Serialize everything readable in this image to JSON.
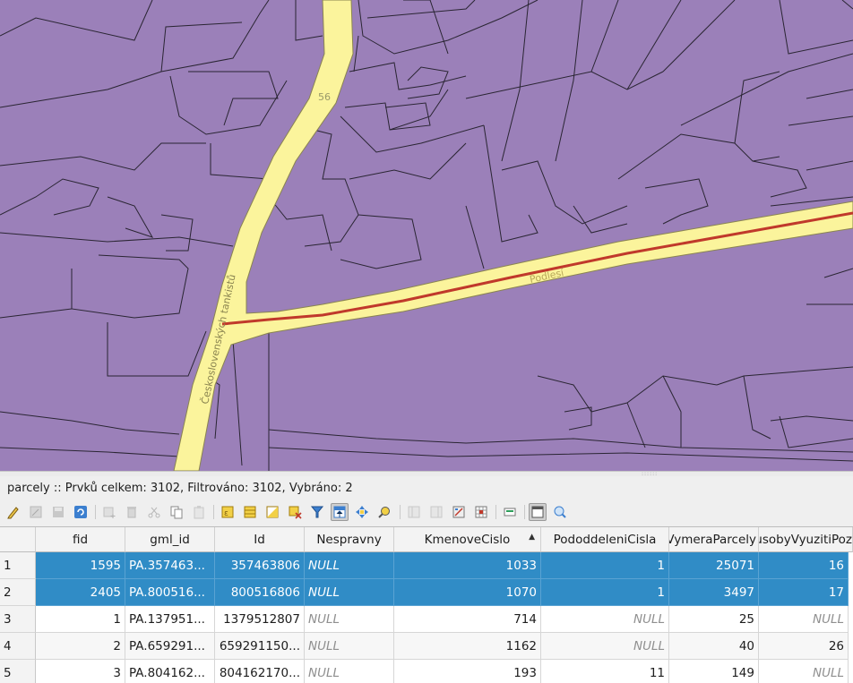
{
  "map": {
    "fill_color": "#9b80b9",
    "road_color": "#fbf49c",
    "road_line_color": "#c0392b",
    "labels": {
      "street_a": "Československých tankistů",
      "street_b": "Podlesí",
      "house_no": "56"
    }
  },
  "attribute_table": {
    "title": "parcely :: Prvků celkem: 3102, Filtrováno: 3102, Vybráno: 2",
    "toolbar": [
      {
        "name": "toggle-editing-icon",
        "enabled": true
      },
      {
        "name": "multi-edit-icon",
        "enabled": false
      },
      {
        "name": "save-edits-icon",
        "enabled": false
      },
      {
        "name": "reload-icon",
        "enabled": true
      },
      {
        "name": "add-feature-icon",
        "enabled": false
      },
      {
        "name": "delete-feature-icon",
        "enabled": false
      },
      {
        "name": "cut-icon",
        "enabled": false
      },
      {
        "name": "copy-icon",
        "enabled": true
      },
      {
        "name": "paste-icon",
        "enabled": false
      },
      {
        "name": "select-by-expression-icon",
        "enabled": true
      },
      {
        "name": "select-all-icon",
        "enabled": true
      },
      {
        "name": "invert-selection-icon",
        "enabled": true
      },
      {
        "name": "deselect-all-icon",
        "enabled": true
      },
      {
        "name": "filter-select-icon",
        "enabled": true
      },
      {
        "name": "move-selection-top-icon",
        "enabled": true,
        "active": true
      },
      {
        "name": "pan-to-selection-icon",
        "enabled": true
      },
      {
        "name": "zoom-to-selection-icon",
        "enabled": true
      },
      {
        "name": "new-field-icon",
        "enabled": false
      },
      {
        "name": "delete-field-icon",
        "enabled": false
      },
      {
        "name": "field-calculator-icon",
        "enabled": true
      },
      {
        "name": "conditional-formatting-icon",
        "enabled": true
      },
      {
        "name": "actions-icon",
        "enabled": true
      },
      {
        "name": "dock-icon",
        "enabled": true,
        "active": true
      },
      {
        "name": "identify-icon",
        "enabled": true
      }
    ],
    "columns": [
      "fid",
      "gml_id",
      "Id",
      "Nespravny",
      "KmenoveCislo",
      "PododdeleniCisla",
      "VymeraParcely",
      "ZpusobyVyuzitiPoz"
    ],
    "sorted_column": "KmenoveCislo",
    "rows": [
      {
        "header": "1",
        "selected": true,
        "cells": [
          "1595",
          "PA.357463...",
          "357463806",
          "NULL",
          "1033",
          "1",
          "25071",
          "16"
        ]
      },
      {
        "header": "2",
        "selected": true,
        "cells": [
          "2405",
          "PA.800516...",
          "800516806",
          "NULL",
          "1070",
          "1",
          "3497",
          "17"
        ]
      },
      {
        "header": "3",
        "selected": false,
        "cells": [
          "1",
          "PA.137951...",
          "1379512807",
          "NULL",
          "714",
          "NULL",
          "25",
          "NULL"
        ]
      },
      {
        "header": "4",
        "selected": false,
        "cells": [
          "2",
          "PA.659291...",
          "659291150...",
          "NULL",
          "1162",
          "NULL",
          "40",
          "26"
        ]
      },
      {
        "header": "5",
        "selected": false,
        "cells": [
          "3",
          "PA.804162...",
          "804162170...",
          "NULL",
          "193",
          "11",
          "149",
          "NULL"
        ]
      }
    ]
  }
}
